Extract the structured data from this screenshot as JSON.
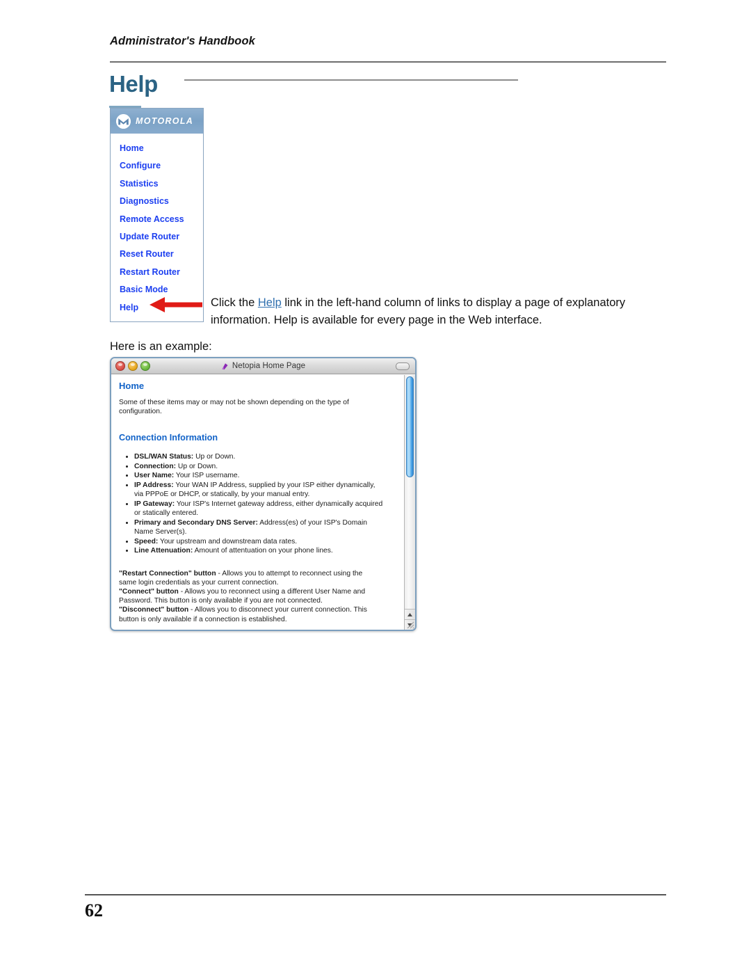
{
  "document": {
    "running_head": "Administrator's Handbook",
    "chapter_title": "Help",
    "page_number": "62"
  },
  "nav_panel": {
    "brand": "MOTOROLA",
    "items": [
      {
        "label": "Home"
      },
      {
        "label": "Configure"
      },
      {
        "label": "Statistics"
      },
      {
        "label": "Diagnostics"
      },
      {
        "label": "Remote Access"
      },
      {
        "label": "Update Router"
      },
      {
        "label": "Reset Router"
      },
      {
        "label": "Restart Router"
      },
      {
        "label": "Basic Mode"
      },
      {
        "label": "Help"
      }
    ]
  },
  "body": {
    "paragraph_lead": "Click the ",
    "paragraph_link": "Help",
    "paragraph_rest": " link in the left-hand column of links to display a page of explanatory information. Help is available for every page in the Web interface.",
    "example_intro": "Here is an example:"
  },
  "browser_window": {
    "title": "Netopia Home Page",
    "heading": "Home",
    "intro": "Some of these items may or may not be shown depending on the type of configuration.",
    "section_heading": "Connection Information",
    "bullets": [
      {
        "term": "DSL/WAN Status:",
        "desc": " Up or Down."
      },
      {
        "term": "Connection:",
        "desc": " Up or Down."
      },
      {
        "term": "User Name:",
        "desc": " Your ISP username."
      },
      {
        "term": "IP Address:",
        "desc": " Your WAN IP Address, supplied by your ISP either dynamically, via PPPoE or DHCP, or statically, by your manual entry."
      },
      {
        "term": "IP Gateway:",
        "desc": " Your ISP's Internet gateway address, either dynamically acquired or statically entered."
      },
      {
        "term": "Primary and Secondary DNS Server:",
        "desc": " Address(es) of your ISP's Domain Name Server(s)."
      },
      {
        "term": "Speed:",
        "desc": " Your upstream and downstream data rates."
      },
      {
        "term": "Line Attenuation:",
        "desc": " Amount of attentuation on your phone lines."
      }
    ],
    "notes": [
      {
        "term": "\"Restart Connection\" button",
        "desc": " - Allows you to attempt to reconnect using the same login credentials as your current connection."
      },
      {
        "term": "\"Connect\" button",
        "desc": " - Allows you to reconnect using a different User Name and Password. This button is only available if you are not connected."
      },
      {
        "term": "\"Disconnect\" button",
        "desc": " - Allows you to disconnect your current connection. This button is only available if a connection is established."
      }
    ]
  },
  "colors": {
    "chapter_title": "#2b6384",
    "nav_link": "#1c3ff0",
    "moto_bar": "#7ba2c6",
    "window_heading": "#1263c8",
    "inline_link": "#2f6fae",
    "arrow": "#e01b16"
  }
}
